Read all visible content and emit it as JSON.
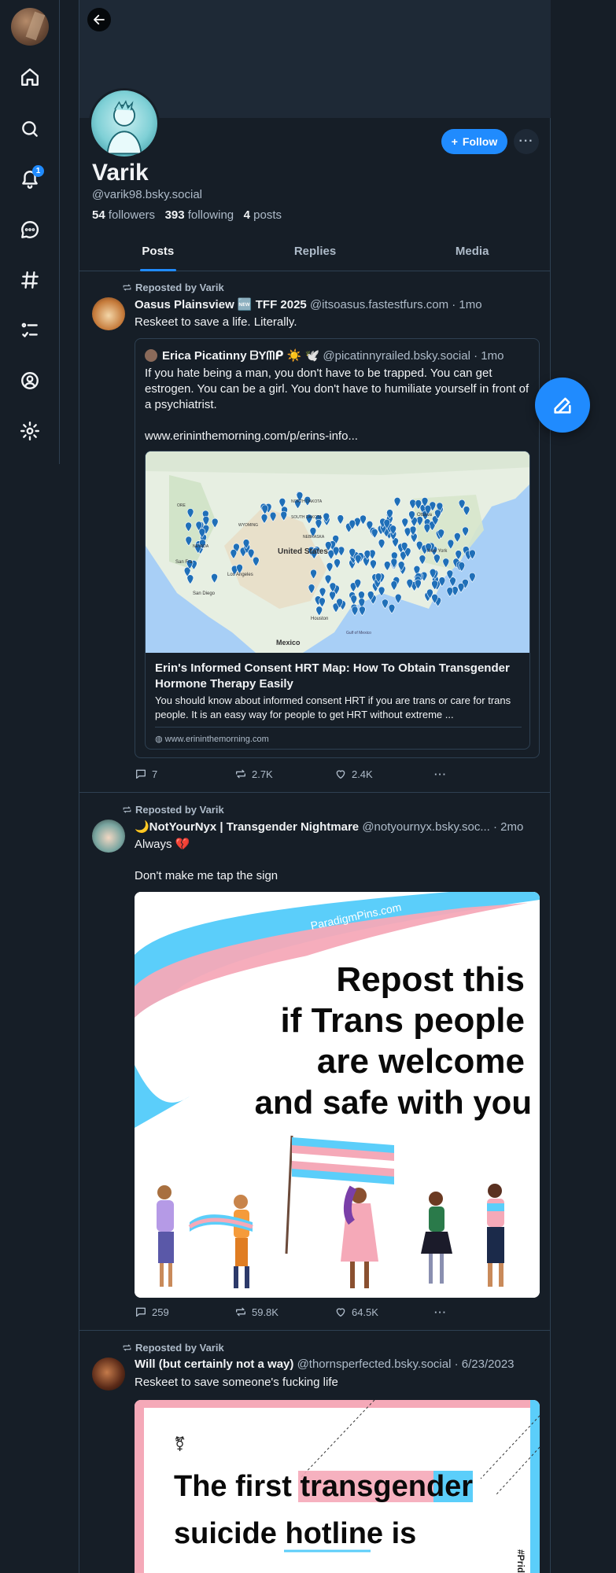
{
  "nav": {
    "notification_count": "1",
    "items": [
      "home-icon",
      "search-icon",
      "bell-icon",
      "chat-icon",
      "hash-icon",
      "list-icon",
      "profile-icon",
      "gear-icon"
    ]
  },
  "profile": {
    "display_name": "Varik",
    "handle": "@varik98.bsky.social",
    "followers_count": "54",
    "followers_label": "followers",
    "following_count": "393",
    "following_label": "following",
    "posts_count": "4",
    "posts_label": "posts",
    "follow_label": "Follow",
    "more_label": "···"
  },
  "tabs": [
    "Posts",
    "Replies",
    "Media"
  ],
  "posts": [
    {
      "reposted_by": "Reposted by Varik",
      "author": "Oasus Plainsview 🆕 TFF 2025",
      "handle": "@itsoasus.fastestfurs.com",
      "time": "· 1mo",
      "text": "Reskeet to save a life. Literally.",
      "quote": {
        "author": "Erica Picatinny ᗷYᗰᑭ ☀️ 🕊️",
        "handle": "@picatinnyrailed.bsky.social",
        "time": "· 1mo",
        "text": "If you hate being a man, you don't have to be trapped. You can get estrogen. You can be a girl. You don't have to humiliate yourself in front of a psychiatrist.",
        "link": "www.erininthemorning.com/p/erins-info...",
        "card_title": "Erin's Informed Consent HRT Map: How To Obtain Transgender Hormone Therapy Easily",
        "card_desc": "You should know about informed consent HRT if you are trans or care for trans people. It is an easy way for people to get HRT without extreme ...",
        "card_domain": "www.erininthemorning.com",
        "map_labels": [
          "United States",
          "Mexico",
          "Los Angeles",
          "San Diego",
          "New York",
          "Ottawa",
          "Houston",
          "Gulf of Mexico",
          "NORTH DAKOTA",
          "NEBRASKA",
          "NEVADA",
          "WYOMING",
          "SOUTH DAKOTA",
          "ORE",
          "San Fra"
        ]
      },
      "replies": "7",
      "reposts": "2.7K",
      "likes": "2.4K"
    },
    {
      "reposted_by": "Reposted by Varik",
      "author": "🌙NotYourNyx | Transgender Nightmare",
      "handle": "@notyournyx.bsky.soc...",
      "time": "· 2mo",
      "text_line1": "Always 💔",
      "text_line2": "Don't make me tap the sign",
      "image": {
        "watermark": "ParadigmPins.com",
        "line1": "Repost this",
        "line2": "if Trans people",
        "line3": "are welcome",
        "line4": "and safe with you"
      },
      "replies": "259",
      "reposts": "59.8K",
      "likes": "64.5K"
    },
    {
      "reposted_by": "Reposted by Varik",
      "author": "Will (but certainly not a way)",
      "handle": "@thornsperfected.bsky.social",
      "time": "· 6/23/2023",
      "text": "Reskeet to save someone's fucking life",
      "image": {
        "symbol": "⚧",
        "line1": "The first transgender",
        "line2": "suicide hotline is",
        "side_tag": "#Pride"
      }
    }
  ],
  "colors": {
    "background": "#161e27",
    "accent": "#208bfe",
    "muted": "#aebbc9",
    "border": "#2e4052"
  }
}
